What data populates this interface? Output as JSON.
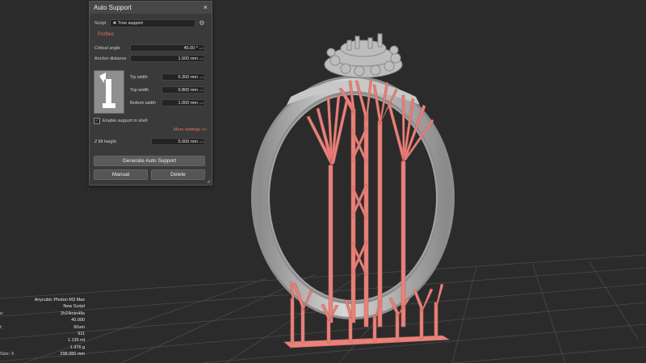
{
  "panel": {
    "title": "Auto Support",
    "close_icon": "×",
    "script_label": "Script",
    "script_value": "Tree support",
    "profiles_label": "Profiles",
    "critical_angle_label": "Critical angle",
    "critical_angle_value": "45.00 °",
    "anchor_distance_label": "Anchor distance",
    "anchor_distance_value": "1.500 mm",
    "tip_width_label": "Tip width",
    "tip_width_value": "0.300 mm",
    "top_width_label": "Top width",
    "top_width_value": "0.800 mm",
    "bottom_width_label": "Bottom width",
    "bottom_width_value": "1.000 mm",
    "enable_support_label": "Enable support in shell",
    "enable_support_checked": true,
    "more_settings_label": "More settings >>",
    "lift_height_label": "Z lift height",
    "lift_height_value": "5.000 mm",
    "generate_label": "Generate Auto Support",
    "manual_label": "Manual",
    "delete_label": "Delete"
  },
  "info": {
    "rows": [
      {
        "key": "",
        "value": "Anycubic Photon M3 Max"
      },
      {
        "key": "",
        "value": "New Script"
      },
      {
        "key": "e:",
        "value": "2h24min49s"
      },
      {
        "key": "",
        "value": "40.000"
      },
      {
        "key": "t:",
        "value": "50um"
      },
      {
        "key": "",
        "value": "911"
      },
      {
        "key": "",
        "value": "1.135 ml"
      },
      {
        "key": "",
        "value": "1.476 g"
      },
      {
        "key": "Size:   X",
        "value": "298.080 mm"
      }
    ]
  },
  "colors": {
    "background": "#2b2b2b",
    "support": "#e8827a",
    "model": "#b9b9b9",
    "accent": "#e8735f",
    "panel": "#3a3a3a"
  },
  "icons": {
    "script_icon": "tree-icon",
    "gear": "gear-icon"
  }
}
